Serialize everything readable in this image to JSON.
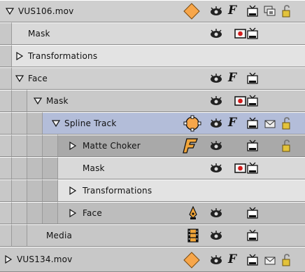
{
  "rows": [
    {
      "label": "VUS106.mov",
      "expanded": true
    },
    {
      "label": "Mask"
    },
    {
      "label": "Transformations",
      "expanded": false
    },
    {
      "label": "Face",
      "expanded": true
    },
    {
      "label": "Mask",
      "expanded": true
    },
    {
      "label": "Spline Track",
      "expanded": true
    },
    {
      "label": "Matte Choker",
      "expanded": false
    },
    {
      "label": "Mask"
    },
    {
      "label": "Transformations",
      "expanded": false
    },
    {
      "label": "Face",
      "expanded": false
    },
    {
      "label": "Media"
    },
    {
      "label": "VUS134.mov",
      "expanded": false
    }
  ],
  "icon_glyphs": {
    "effect_letter": "F",
    "filter_letter": "F"
  },
  "colors": {
    "row_gray": "#cfcfcf",
    "row_light": "#d9d9d9",
    "row_mid": "#bdbdbd",
    "row_dark": "#a9a9a9",
    "selected_blue": "#b3bdd9",
    "diamond_orange": "#f7a64a",
    "lock_yellow": "#e3c33b",
    "matte_orange": "#f0a53a"
  }
}
